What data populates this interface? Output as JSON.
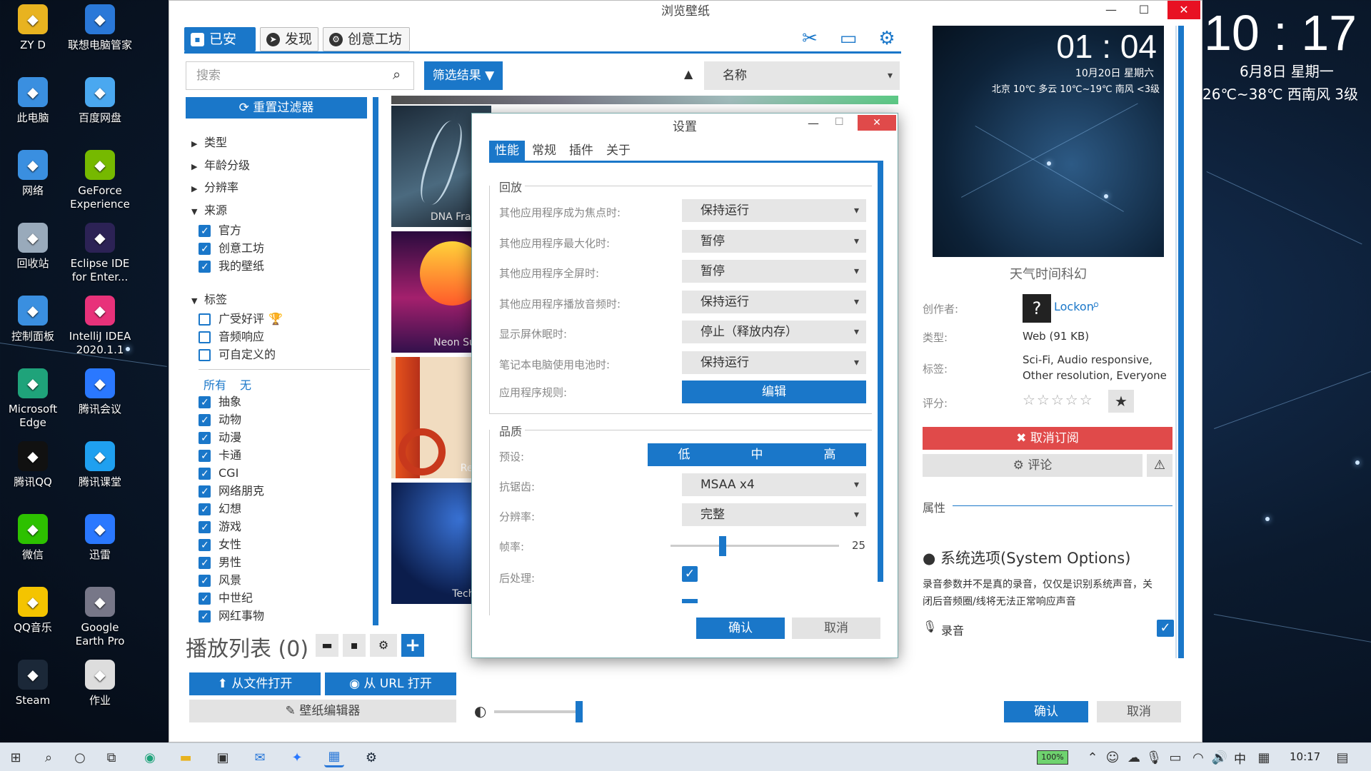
{
  "clock": {
    "time": "10 : 17",
    "date": "6月8日 星期一",
    "weather": "26℃~38℃ 西南风 3级"
  },
  "desktop_icons": [
    {
      "label": "ZY D",
      "icon": "folder-icon",
      "color": "#e8b320"
    },
    {
      "label": "联想电脑管家",
      "icon": "lenovo-icon",
      "color": "#2a78d8"
    },
    {
      "label": "此电脑",
      "icon": "computer-icon",
      "color": "#3a8fe0"
    },
    {
      "label": "百度网盘",
      "icon": "baidu-netdisk-icon",
      "color": "#4aa8f0"
    },
    {
      "label": "网络",
      "icon": "network-icon",
      "color": "#3a8fe0"
    },
    {
      "label": "GeForce Experience",
      "icon": "nvidia-icon",
      "color": "#76b900"
    },
    {
      "label": "回收站",
      "icon": "recycle-bin-icon",
      "color": "#9ab"
    },
    {
      "label": "Eclipse IDE for Enter...",
      "icon": "eclipse-icon",
      "color": "#2c2255"
    },
    {
      "label": "控制面板",
      "icon": "control-panel-icon",
      "color": "#3a8fe0"
    },
    {
      "label": "IntelliJ IDEA 2020.1.1",
      "icon": "intellij-icon",
      "color": "#e8327a"
    },
    {
      "label": "Microsoft Edge",
      "icon": "edge-icon",
      "color": "#1fa37a"
    },
    {
      "label": "腾讯会议",
      "icon": "tencent-meeting-icon",
      "color": "#2a78ff"
    },
    {
      "label": "腾讯QQ",
      "icon": "qq-icon",
      "color": "#111"
    },
    {
      "label": "腾讯课堂",
      "icon": "tencent-classroom-icon",
      "color": "#1fa0f0"
    },
    {
      "label": "微信",
      "icon": "wechat-icon",
      "color": "#2dc100"
    },
    {
      "label": "迅雷",
      "icon": "thunder-icon",
      "color": "#2a78ff"
    },
    {
      "label": "QQ音乐",
      "icon": "qq-music-icon",
      "color": "#f4c400"
    },
    {
      "label": "Google Earth Pro",
      "icon": "google-earth-icon",
      "color": "#778"
    },
    {
      "label": "Steam",
      "icon": "steam-icon",
      "color": "#1b2838"
    },
    {
      "label": "作业",
      "icon": "document-icon",
      "color": "#ddd"
    }
  ],
  "window": {
    "title": "浏览壁纸",
    "tabs": [
      "已安装",
      "发现",
      "创意工坊"
    ],
    "search_placeholder": "搜索",
    "filter_btn": "筛选结果",
    "sort_label": "名称",
    "reset_filters": "重置过滤器",
    "tree": {
      "type": "类型",
      "age": "年龄分级",
      "resolution": "分辨率",
      "source": "来源",
      "tags": "标签"
    },
    "source_items": [
      "官方",
      "创意工坊",
      "我的壁纸"
    ],
    "tag_special": [
      "广受好评",
      "音频响应",
      "可自定义的"
    ],
    "all_none": [
      "所有",
      "无"
    ],
    "tag_items": [
      "抽象",
      "动物",
      "动漫",
      "卡通",
      "CGI",
      "网络朋克",
      "幻想",
      "游戏",
      "女性",
      "男性",
      "风景",
      "中世纪",
      "网红事物"
    ],
    "thumbnails": [
      "DNA Fragm",
      "Neon Suns",
      "Retro",
      "Techno"
    ],
    "playlist": "播放列表 (0)",
    "open_file": "从文件打开",
    "open_url": "从 URL 打开",
    "editor": "壁纸编辑器",
    "ok": "确认",
    "cancel": "取消"
  },
  "preview": {
    "time": "01 : 04",
    "date": "10月20日 星期六",
    "weather": "北京 10℃ 多云 10℃~19℃ 南风 <3级",
    "title": "天气时间科幻"
  },
  "info": {
    "creator_label": "创作者:",
    "creator": "Lockon",
    "type_label": "类型:",
    "type": "Web (91 KB)",
    "tags_label": "标签:",
    "tags_line1": "Sci-Fi, Audio responsive,",
    "tags_line2": "Other resolution, Everyone",
    "rating_label": "评分:",
    "rating": 0,
    "rating_max": 5,
    "unsubscribe": "取消订阅",
    "comment": "评论",
    "props_label": "属性",
    "sys_options": "系统选项(System Options)",
    "desc_line1": "录音参数并不是真的录音，仅仅是识别系统声音，关",
    "desc_line2": "闭后音频圈/线将无法正常响应声音",
    "record_label": "录音"
  },
  "settings": {
    "title": "设置",
    "tabs": [
      "性能",
      "常规",
      "插件",
      "关于"
    ],
    "playback_section": "回放",
    "rows": [
      {
        "label": "其他应用程序成为焦点时:",
        "value": "保持运行"
      },
      {
        "label": "其他应用程序最大化时:",
        "value": "暂停"
      },
      {
        "label": "其他应用程序全屏时:",
        "value": "暂停"
      },
      {
        "label": "其他应用程序播放音频时:",
        "value": "保持运行"
      },
      {
        "label": "显示屏休眠时:",
        "value": "停止（释放内存）"
      },
      {
        "label": "笔记本电脑使用电池时:",
        "value": "保持运行"
      }
    ],
    "app_rules_label": "应用程序规则:",
    "edit_btn": "编辑",
    "quality_section": "品质",
    "preset_label": "预设:",
    "presets": [
      "低",
      "中",
      "高"
    ],
    "aa_label": "抗锯齿:",
    "aa_value": "MSAA x4",
    "res_label": "分辨率:",
    "res_value": "完整",
    "fps_label": "帧率:",
    "fps_value": "25",
    "post_label": "后处理:",
    "ok": "确认",
    "cancel": "取消"
  },
  "taskbar": {
    "battery": "100%",
    "ime": "中",
    "time": "10:17"
  }
}
